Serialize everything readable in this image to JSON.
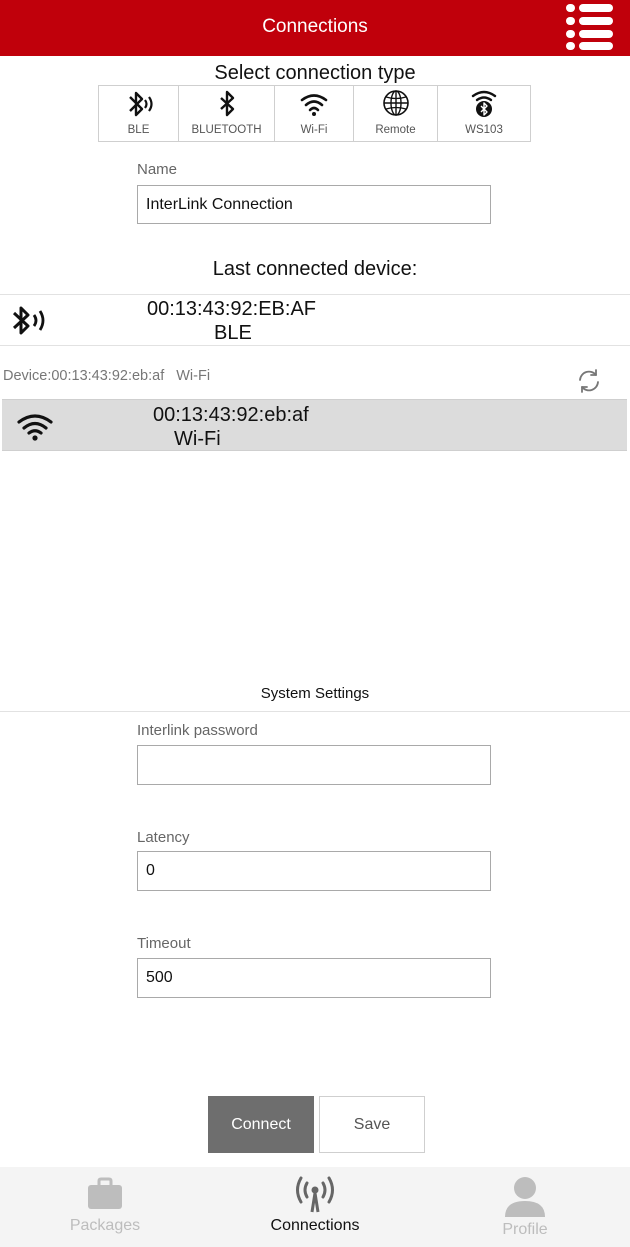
{
  "header": {
    "title": "Connections"
  },
  "connection_types": {
    "title": "Select connection type",
    "items": [
      {
        "label": "BLE",
        "icon": "bluetooth-waves-icon"
      },
      {
        "label": "BLUETOOTH",
        "icon": "bluetooth-icon"
      },
      {
        "label": "Wi-Fi",
        "icon": "wifi-icon"
      },
      {
        "label": "Remote",
        "icon": "globe-icon"
      },
      {
        "label": "WS103",
        "icon": "ws103-icon"
      }
    ]
  },
  "name_field": {
    "label": "Name",
    "value": "InterLink Connection"
  },
  "last_connected": {
    "title": "Last connected device:",
    "address": "00:13:43:92:EB:AF",
    "type": "BLE"
  },
  "device_status": {
    "device": "Device:00:13:43:92:eb:af",
    "type": "Wi-Fi"
  },
  "found_device": {
    "address": "00:13:43:92:eb:af",
    "type": "Wi-Fi"
  },
  "system_settings": {
    "title": "System Settings",
    "password": {
      "label": "Interlink password",
      "value": ""
    },
    "latency": {
      "label": "Latency",
      "value": "0"
    },
    "timeout": {
      "label": "Timeout",
      "value": "500"
    }
  },
  "actions": {
    "connect": "Connect",
    "save": "Save"
  },
  "bottom_nav": {
    "items": [
      {
        "label": "Packages",
        "icon": "briefcase-icon",
        "active": false
      },
      {
        "label": "Connections",
        "icon": "antenna-icon",
        "active": true
      },
      {
        "label": "Profile",
        "icon": "person-icon",
        "active": false
      }
    ]
  },
  "colors": {
    "header": "#c0000b",
    "connect_button": "#6e6e6e",
    "selected_row": "#dcdcdc"
  }
}
